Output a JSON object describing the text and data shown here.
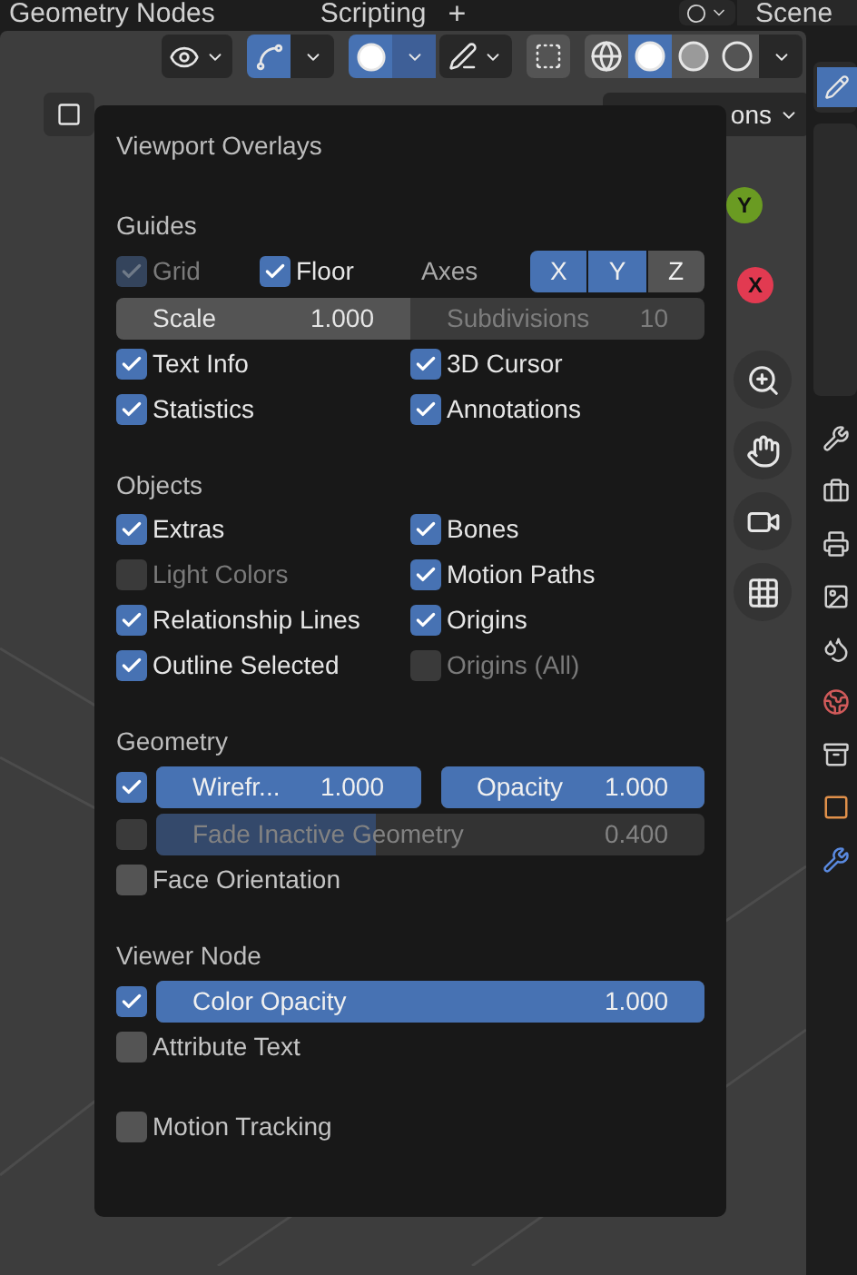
{
  "topbar": {
    "tabs": [
      {
        "label": "Geometry Nodes",
        "selected": false
      },
      {
        "label": "Scripting",
        "selected": false
      }
    ],
    "add_tab": "+",
    "scene": "Scene"
  },
  "header": {
    "visibility_on": false,
    "gizmo_on": true,
    "overlays_on": true,
    "overlays_menu_open": true,
    "xray_on": false,
    "shading": [
      {
        "kind": "wireframe",
        "selected": false
      },
      {
        "kind": "solid",
        "selected": true
      },
      {
        "kind": "material",
        "selected": false
      },
      {
        "kind": "rendered",
        "selected": false
      }
    ]
  },
  "header_row2": {
    "options_label": "ons"
  },
  "gizmo_axes": [
    {
      "label": "Y",
      "color": "#6a9b22"
    },
    {
      "label": "X",
      "color": "#e23a51"
    }
  ],
  "popover": {
    "title": "Viewport Overlays",
    "sections": [
      {
        "title": "Guides",
        "rows": [
          {
            "kind": "grid",
            "grid": {
              "label": "Grid",
              "checked": true,
              "disabled": true
            },
            "floor": {
              "label": "Floor",
              "checked": true,
              "disabled": false
            },
            "axes_label": "Axes",
            "axes": [
              {
                "label": "X",
                "selected": true
              },
              {
                "label": "Y",
                "selected": true
              },
              {
                "label": "Z",
                "selected": false
              }
            ]
          },
          {
            "kind": "fields",
            "fields": [
              {
                "label": "Scale",
                "value": "1.000",
                "disabled": false
              },
              {
                "label": "Subdivisions",
                "value": "10",
                "disabled": true
              }
            ]
          },
          {
            "kind": "checks",
            "items": [
              {
                "label": "Text Info",
                "checked": true,
                "disabled": false
              },
              {
                "label": "3D Cursor",
                "checked": true,
                "disabled": false
              }
            ]
          },
          {
            "kind": "checks",
            "items": [
              {
                "label": "Statistics",
                "checked": true,
                "disabled": false
              },
              {
                "label": "Annotations",
                "checked": true,
                "disabled": false
              }
            ]
          }
        ]
      },
      {
        "title": "Objects",
        "rows": [
          {
            "kind": "checks",
            "items": [
              {
                "label": "Extras",
                "checked": true,
                "disabled": false
              },
              {
                "label": "Bones",
                "checked": true,
                "disabled": false
              }
            ]
          },
          {
            "kind": "checks",
            "items": [
              {
                "label": "Light Colors",
                "checked": false,
                "disabled": true
              },
              {
                "label": "Motion Paths",
                "checked": true,
                "disabled": false
              }
            ]
          },
          {
            "kind": "checks",
            "items": [
              {
                "label": "Relationship Lines",
                "checked": true,
                "disabled": false
              },
              {
                "label": "Origins",
                "checked": true,
                "disabled": false
              }
            ]
          },
          {
            "kind": "checks",
            "items": [
              {
                "label": "Outline Selected",
                "checked": true,
                "disabled": false
              },
              {
                "label": "Origins (All)",
                "checked": false,
                "disabled": true
              }
            ]
          }
        ]
      },
      {
        "title": "Geometry",
        "rows": [
          {
            "kind": "check_sliders",
            "checked": true,
            "disabled": false,
            "sliders": [
              {
                "label": "Wirefr...",
                "value": "1.000",
                "level": 1
              },
              {
                "label": "Opacity",
                "value": "1.000",
                "level": 1
              }
            ]
          },
          {
            "kind": "check_sliders",
            "checked": false,
            "disabled": true,
            "sliders": [
              {
                "label": "Fade Inactive Geometry",
                "value": "0.400",
                "level": 0.4
              }
            ]
          },
          {
            "kind": "checks",
            "items": [
              {
                "label": "Face Orientation",
                "checked": false,
                "disabled": false
              }
            ]
          }
        ]
      },
      {
        "title": "Viewer Node",
        "rows": [
          {
            "kind": "check_sliders",
            "checked": true,
            "disabled": false,
            "sliders": [
              {
                "label": "Color Opacity",
                "value": "1.000",
                "level": 1
              }
            ]
          },
          {
            "kind": "checks",
            "items": [
              {
                "label": "Attribute Text",
                "checked": false,
                "disabled": false
              }
            ]
          }
        ]
      },
      {
        "rows": [
          {
            "kind": "checks",
            "items": [
              {
                "label": "Motion Tracking",
                "checked": false,
                "disabled": false
              }
            ]
          }
        ]
      }
    ]
  }
}
